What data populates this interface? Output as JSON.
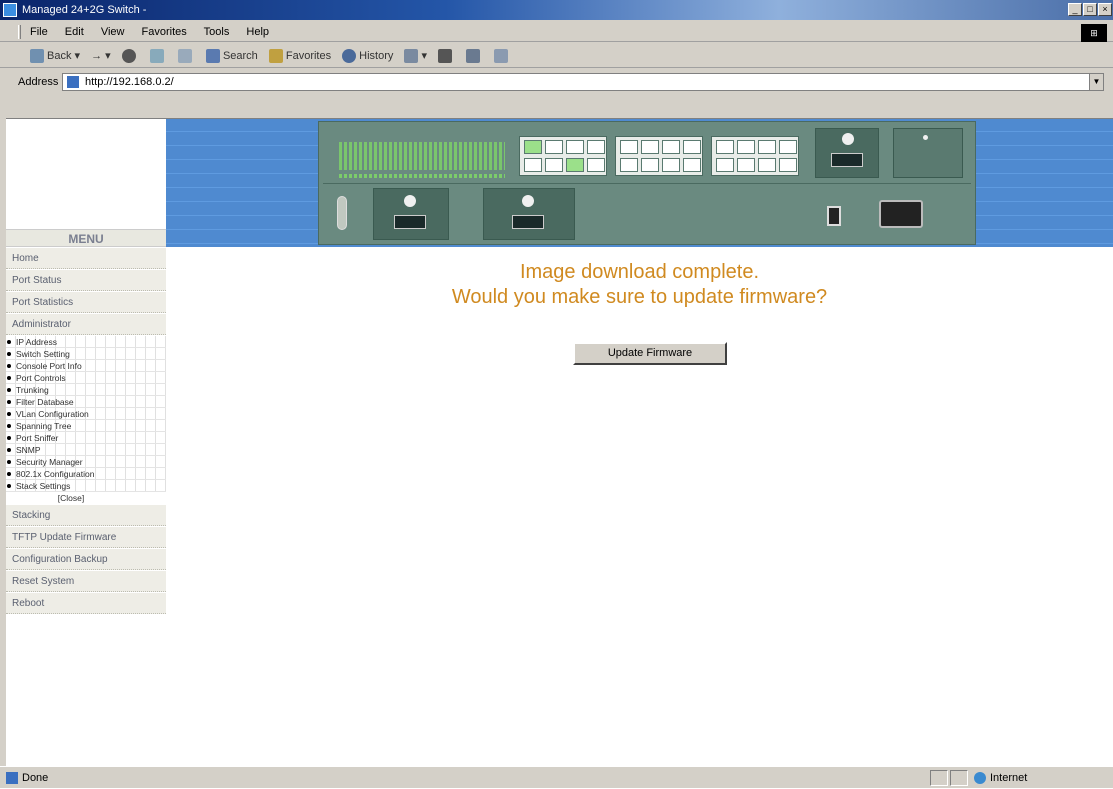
{
  "window": {
    "title": "Managed 24+2G Switch -",
    "controls": [
      "_",
      "□",
      "×"
    ]
  },
  "menubar": {
    "items": [
      "File",
      "Edit",
      "View",
      "Favorites",
      "Tools",
      "Help"
    ]
  },
  "toolbar": {
    "back": "Back",
    "forward": "→",
    "search": "Search",
    "favorites": "Favorites",
    "history": "History"
  },
  "address": {
    "label": "Address",
    "url": "http://192.168.0.2/"
  },
  "sidebar": {
    "heading": "MENU",
    "top_items": [
      "Home",
      "Port Status",
      "Port Statistics",
      "Administrator"
    ],
    "admin_subitems": [
      "IP Address",
      "Switch Setting",
      "Console Port Info",
      "Port Controls",
      "Trunking",
      "Filter Database",
      "VLan Configuration",
      "Spanning Tree",
      "Port Sniffer",
      "SNMP",
      "Security Manager",
      "802.1x Configuration",
      "Stack Settings"
    ],
    "close_label": "[Close]",
    "bottom_items": [
      "Stacking",
      "TFTP Update Firmware",
      "Configuration Backup",
      "Reset System",
      "Reboot"
    ]
  },
  "main": {
    "message_line1": "Image download complete.",
    "message_line2": "Would you make sure to update firmware?",
    "update_button": "Update Firmware",
    "message_color": "#d08a20"
  },
  "statusbar": {
    "status": "Done",
    "zone": "Internet"
  }
}
